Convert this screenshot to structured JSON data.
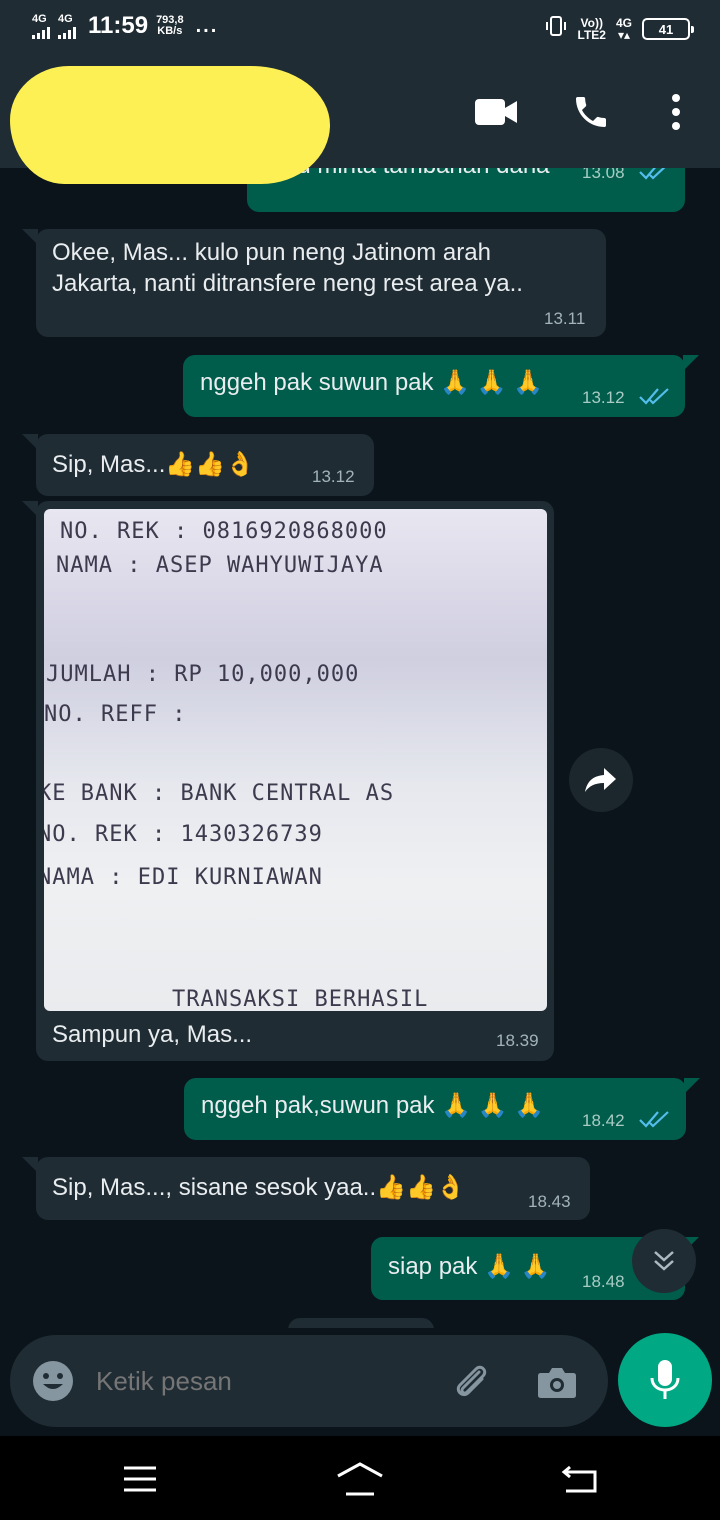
{
  "status_bar": {
    "sim1": "4G",
    "sim2": "4G",
    "time": "11:59",
    "speed_value": "793,8",
    "speed_unit": "KB/s",
    "more": "...",
    "volte_top": "Vo))",
    "volte_bottom": "LTE2",
    "net": "4G",
    "battery": "41"
  },
  "header": {
    "icons": [
      "video-call-icon",
      "voice-call-icon",
      "more-vert-icon"
    ]
  },
  "messages": [
    {
      "dir": "out",
      "lines": [
        "mau minta tambahan dana"
      ],
      "time": "13.08",
      "read": true
    },
    {
      "dir": "in",
      "lines": [
        "Okee, Mas... kulo pun neng Jatinom arah",
        "Jakarta, nanti ditransfere neng rest area ya.."
      ],
      "time": "13.11"
    },
    {
      "dir": "out",
      "lines": [
        "nggeh pak suwun pak 🙏 🙏 🙏"
      ],
      "time": "13.12",
      "read": true
    },
    {
      "dir": "in",
      "lines": [
        "Sip, Mas...👍👍👌"
      ],
      "time": "13.12"
    },
    {
      "dir": "in",
      "caption": "Sampun ya, Mas...",
      "time": "18.39"
    },
    {
      "dir": "out",
      "lines": [
        "nggeh pak,suwun pak 🙏 🙏 🙏"
      ],
      "time": "18.42",
      "read": true
    },
    {
      "dir": "in",
      "lines": [
        "Sip, Mas..., sisane sesok yaa..👍👍👌"
      ],
      "time": "18.43"
    },
    {
      "dir": "out",
      "lines": [
        "siap pak 🙏 🙏"
      ],
      "time": "18.48"
    }
  ],
  "receipt": {
    "lines": [
      "NO. REK    :  0816920868000",
      "NAMA       : ASEP WAHYUWIJAYA",
      "JUMLAH     : RP       10,000,000",
      "NO. REFF   :",
      "KE BANK    : BANK CENTRAL AS",
      "NO. REK    : 1430326739",
      "NAMA       : EDI KURNIAWAN",
      "TRANSAKSI BERHASIL"
    ]
  },
  "input": {
    "placeholder": "Ketik pesan"
  },
  "colors": {
    "background": "#0b141a",
    "incoming": "#1f2c34",
    "outgoing": "#005c4b",
    "accent": "#00a884",
    "read_ticks": "#53bdeb",
    "redaction": "#fdf055"
  }
}
